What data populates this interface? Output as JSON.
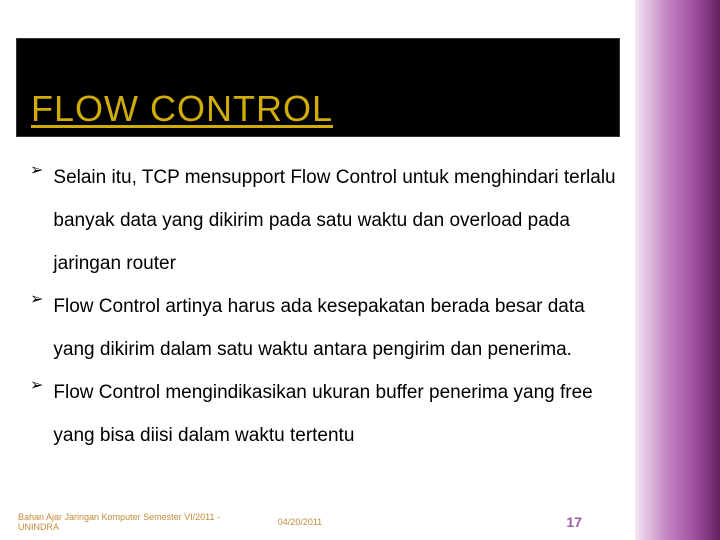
{
  "title": "FLOW CONTROL",
  "bullets": [
    "Selain itu, TCP mensupport Flow Control untuk menghindari terlalu banyak data yang dikirim pada satu waktu dan overload pada jaringan router",
    "Flow Control artinya harus ada kesepakatan berada besar data yang dikirim dalam satu waktu antara pengirim dan penerima.",
    "Flow Control mengindikasikan ukuran buffer penerima yang free yang bisa diisi dalam waktu tertentu"
  ],
  "footer": {
    "left": "Bahan Ajar Jaringan Komputer Semester VI/2011 - UNINDRA",
    "center": "04/20/2011",
    "right": "17"
  }
}
